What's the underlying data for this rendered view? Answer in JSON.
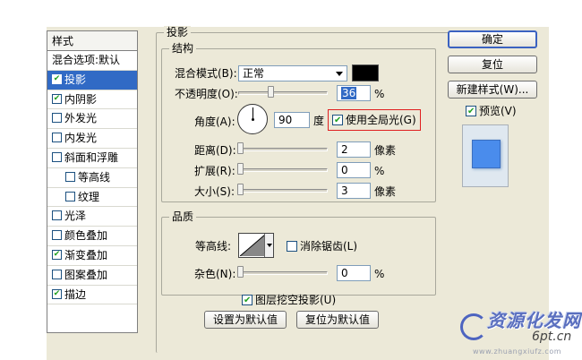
{
  "styles": {
    "header": "样式",
    "items": [
      {
        "label": "混合选项:默认",
        "checkbox": false,
        "checked": false,
        "sub": false,
        "selected": false
      },
      {
        "label": "投影",
        "checkbox": true,
        "checked": true,
        "sub": false,
        "selected": true
      },
      {
        "label": "内阴影",
        "checkbox": true,
        "checked": true,
        "sub": false,
        "selected": false
      },
      {
        "label": "外发光",
        "checkbox": true,
        "checked": false,
        "sub": false,
        "selected": false
      },
      {
        "label": "内发光",
        "checkbox": true,
        "checked": false,
        "sub": false,
        "selected": false
      },
      {
        "label": "斜面和浮雕",
        "checkbox": true,
        "checked": false,
        "sub": false,
        "selected": false
      },
      {
        "label": "等高线",
        "checkbox": true,
        "checked": false,
        "sub": true,
        "selected": false
      },
      {
        "label": "纹理",
        "checkbox": true,
        "checked": false,
        "sub": true,
        "selected": false
      },
      {
        "label": "光泽",
        "checkbox": true,
        "checked": false,
        "sub": false,
        "selected": false
      },
      {
        "label": "颜色叠加",
        "checkbox": true,
        "checked": false,
        "sub": false,
        "selected": false
      },
      {
        "label": "渐变叠加",
        "checkbox": true,
        "checked": true,
        "sub": false,
        "selected": false
      },
      {
        "label": "图案叠加",
        "checkbox": true,
        "checked": false,
        "sub": false,
        "selected": false
      },
      {
        "label": "描边",
        "checkbox": true,
        "checked": true,
        "sub": false,
        "selected": false
      }
    ]
  },
  "drop_shadow": {
    "section_title": "投影",
    "structure": {
      "title": "结构",
      "blend_mode_label": "混合模式(B):",
      "blend_mode_value": "正常",
      "shadow_color": "#000000",
      "opacity_label": "不透明度(O):",
      "opacity_value": "36",
      "opacity_unit": "%",
      "opacity_fraction": 0.36,
      "angle_label": "角度(A):",
      "angle_value": "90",
      "angle_unit": "度",
      "global_light_label": "使用全局光(G)",
      "global_light_checked": true,
      "distance_label": "距离(D):",
      "distance_value": "2",
      "distance_unit": "像素",
      "spread_label": "扩展(R):",
      "spread_value": "0",
      "spread_unit": "%",
      "size_label": "大小(S):",
      "size_value": "3",
      "size_unit": "像素"
    },
    "quality": {
      "title": "品质",
      "contour_label": "等高线:",
      "anti_aliased_label": "消除锯齿(L)",
      "anti_aliased_checked": false,
      "noise_label": "杂色(N):",
      "noise_value": "0",
      "noise_unit": "%"
    },
    "knockout_label": "图层挖空投影(U)",
    "knockout_checked": true,
    "make_default_label": "设置为默认值",
    "reset_default_label": "复位为默认值"
  },
  "buttons": {
    "ok": "确定",
    "reset": "复位",
    "new_style": "新建样式(W)...",
    "preview_label": "预览(V)",
    "preview_checked": true
  },
  "watermark": {
    "title": "资源化发网",
    "site": "6pt.cn",
    "url": "www.zhuangxiufz.com"
  },
  "colors": {
    "dialog_bg": "#ece9d8",
    "selection": "#316ac5",
    "preview_fill": "#4a8cec",
    "highlight": "#e02020"
  }
}
